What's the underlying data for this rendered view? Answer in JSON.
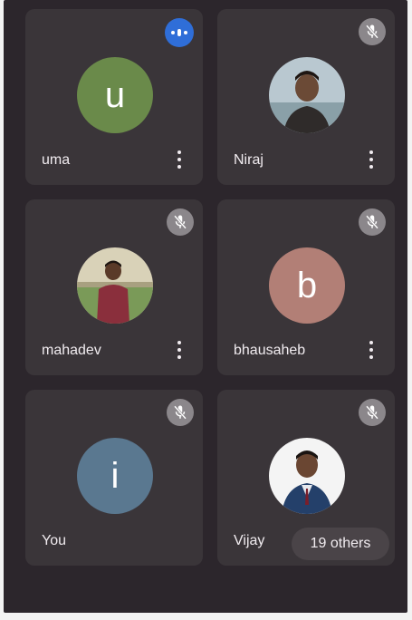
{
  "colors": {
    "background": "#2c262c",
    "tile": "#3a3539",
    "speaking_indicator": "#2f6ed8",
    "muted_indicator": "#8b878b"
  },
  "participants": [
    {
      "name": "uma",
      "initial": "u",
      "avatar_color": "#6a8a4a",
      "status": "speaking"
    },
    {
      "name": "Niraj",
      "avatar": "photo",
      "status": "muted"
    },
    {
      "name": "mahadev",
      "avatar": "photo",
      "status": "muted"
    },
    {
      "name": "bhausaheb",
      "initial": "b",
      "avatar_color": "#b27f76",
      "status": "muted"
    },
    {
      "name": "You",
      "initial": "i",
      "avatar_color": "#5a7890",
      "status": "muted"
    },
    {
      "name": "Vijay",
      "avatar": "photo",
      "status": "muted"
    }
  ],
  "others_label": "19 others",
  "icons": {
    "muted": "mic-off-icon",
    "speaking": "audio-level-icon",
    "more": "more-vert-icon"
  }
}
